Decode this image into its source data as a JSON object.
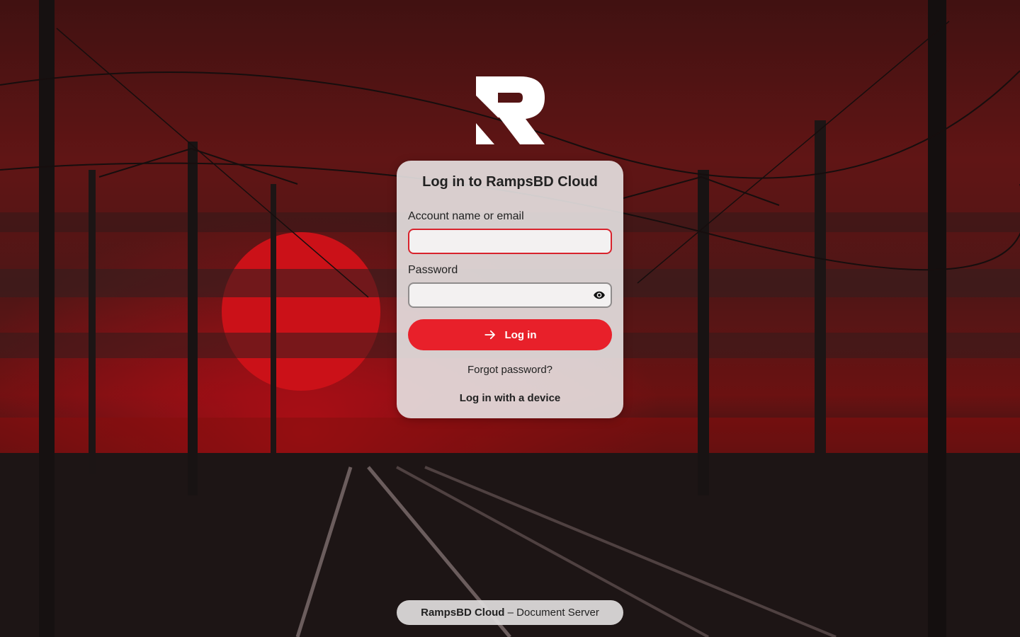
{
  "login": {
    "title": "Log in to RampsBD Cloud",
    "username_label": "Account name or email",
    "username_value": "",
    "password_label": "Password",
    "password_value": "",
    "login_button": "Log in",
    "forgot_password": "Forgot password?",
    "device_login": "Log in with a device"
  },
  "footer": {
    "brand": "RampsBD Cloud",
    "separator": " – ",
    "subtitle": "Document Server"
  },
  "icons": {
    "logo": "r-logo-icon",
    "show_password": "eye-icon",
    "login_arrow": "arrow-right-icon"
  },
  "colors": {
    "accent": "#e8202a",
    "error_border": "#d8222c",
    "card_bg": "#e7e2e2"
  }
}
